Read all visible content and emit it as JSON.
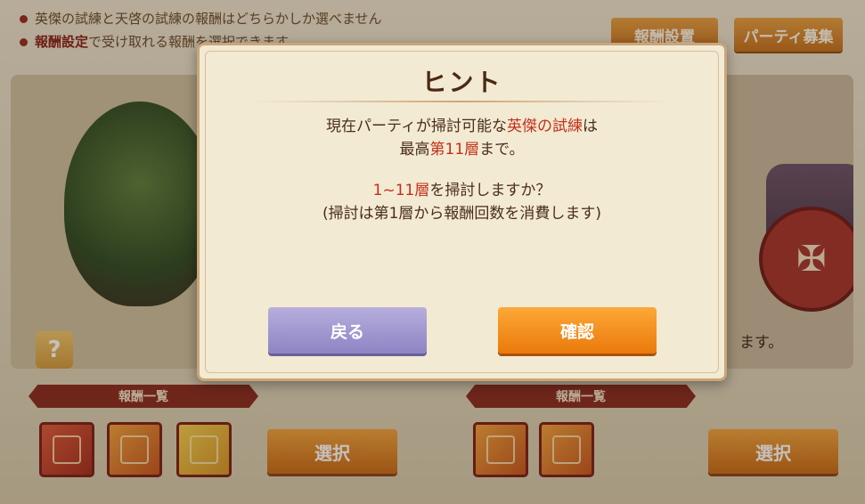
{
  "notes": [
    {
      "text": "英傑の試練と天啓の試練の報酬はどちらかしか選べません",
      "strong": ""
    },
    {
      "text": "で受け取れる報酬を選択できます。",
      "strong": "報酬設定"
    }
  ],
  "header": {
    "reward_settings": "報酬設置",
    "party_recruit": "パーティ募集"
  },
  "help_icon_glyph": "?",
  "right_card_fragment": "ます。",
  "left_panel": {
    "ribbon": "報酬一覧",
    "select": "選択",
    "rewards": [
      "red",
      "orange",
      "gold"
    ]
  },
  "right_panel": {
    "ribbon": "報酬一覧",
    "select": "選択",
    "rewards": [
      "orange",
      "orange"
    ]
  },
  "dialog": {
    "title": "ヒント",
    "line1_pre": "現在パーティが掃討可能な",
    "line1_hl": "英傑の試練",
    "line1_post": "は",
    "line2_pre": "最高",
    "line2_hl": "第11層",
    "line2_post": "まで。",
    "line3_hl": "1~11層",
    "line3_post": "を掃討しますか？",
    "line4": "(掃討は第1層から報酬回数を消費します)",
    "back": "戻る",
    "confirm": "確認"
  },
  "colors": {
    "accent": "#c2301a",
    "confirm": "#ea7a0b",
    "back": "#8d84c4"
  }
}
